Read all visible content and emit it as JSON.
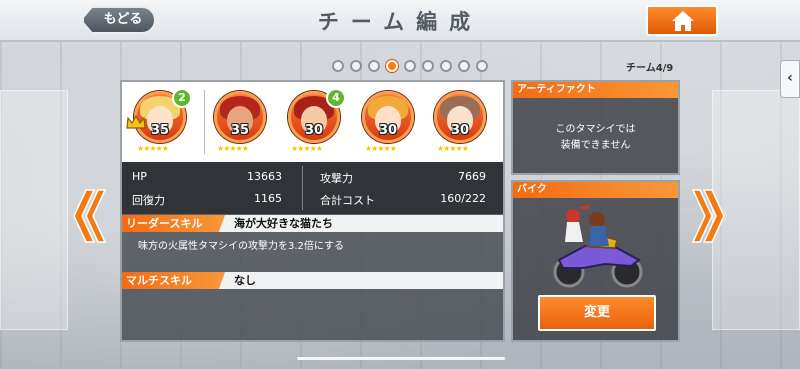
{
  "header": {
    "title": "チーム編成",
    "back_label": "もどる"
  },
  "pager": {
    "total": 9,
    "current": 4,
    "team_label": "チーム4/9"
  },
  "team": {
    "units": [
      {
        "level": "35",
        "badge": "2",
        "leader": true,
        "stars": 5,
        "hair": "#f3d36e",
        "face": "#fde3c8"
      },
      {
        "level": "35",
        "badge": "",
        "leader": false,
        "stars": 5,
        "hair": "#b3261e",
        "face": "#e6a57f"
      },
      {
        "level": "30",
        "badge": "4",
        "leader": false,
        "stars": 5,
        "hair": "#a8221b",
        "face": "#f4caa7"
      },
      {
        "level": "30",
        "badge": "",
        "leader": false,
        "stars": 5,
        "hair": "#f1a93a",
        "face": "#fde0c6"
      },
      {
        "level": "30",
        "badge": "",
        "leader": false,
        "stars": 5,
        "hair": "#9a6e55",
        "face": "#fbe0cc"
      }
    ]
  },
  "stats": {
    "hp_label": "HP",
    "hp_value": "13663",
    "heal_label": "回復力",
    "heal_value": "1165",
    "atk_label": "攻撃力",
    "atk_value": "7669",
    "cost_label": "合計コスト",
    "cost_value": "160/222"
  },
  "leader_skill": {
    "label": "リーダースキル",
    "name": "海が大好きな猫たち",
    "description": "味方の火属性タマシイの攻撃力を3.2倍にする"
  },
  "multi_skill": {
    "label": "マルチスキル",
    "name": "なし"
  },
  "artifact": {
    "label": "アーティファクト",
    "message_line1": "このタマシイでは",
    "message_line2": "装備できません"
  },
  "bike": {
    "label": "バイク",
    "change_label": "変更"
  },
  "side_tab": {
    "glyph": "‹"
  },
  "colors": {
    "accent": "#f36b12",
    "badge": "#5db82e",
    "star": "#f5c400"
  }
}
